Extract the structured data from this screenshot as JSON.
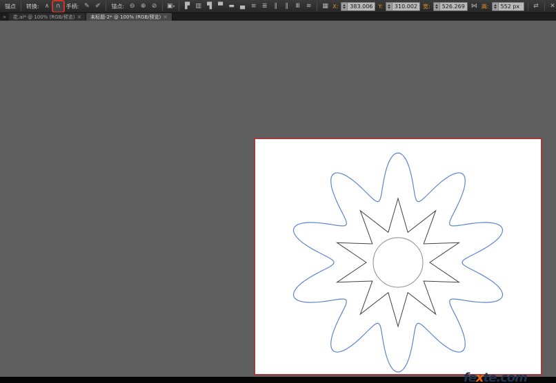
{
  "control_bar": {
    "anchor_title": "锚点",
    "convert_label": "转换:",
    "handles_label": "手柄:",
    "anchors_label": "锚点:",
    "x_label": "X:",
    "x_value": "383.006",
    "y_label": "Y:",
    "y_value": "310.002",
    "w_label": "宽:",
    "w_value": "526.269",
    "h_label": "高:",
    "h_value": "552 px"
  },
  "icons": {
    "convert_corner": "∧",
    "convert_smooth": "∩",
    "handles_show": "✎",
    "handles_hide": "✐",
    "remove_anchor": "⊖",
    "add_anchor": "⊕",
    "cut_path": "⊘",
    "isolate": "▣",
    "caret": "▾",
    "align_left": "▛",
    "align_center": "▥",
    "align_right": "▜",
    "align_top": "▀",
    "align_middle": "▬",
    "align_bottom": "▄",
    "dist_top": "≡",
    "dist_middle": "≣",
    "dist_bottom": "∥",
    "dist_left": "‖",
    "dist_center": "Ⅲ",
    "dist_right": "≋",
    "ref_point": "▦",
    "link": "⋈",
    "swap": "⇄",
    "close": "✕",
    "tab_chevrons": "»",
    "tab_close": "×"
  },
  "tab_bar": {
    "tabs": [
      {
        "label": "花.ai* @ 100% (RGB/预览)"
      },
      {
        "label": "未标题-2* @ 100% (RGB/预览)"
      }
    ]
  },
  "canvas": {
    "artboard": {
      "border_color": "#a03c3c",
      "background": "#ffffff"
    },
    "flower": {
      "petals": 10,
      "star_points": 10,
      "outline_color": "#5b84cf",
      "star_color": "#3f3f3f",
      "circle_color": "#8a8a8a"
    }
  },
  "watermark": {
    "left": "fe",
    "accent": "x",
    "right": "te.com"
  }
}
